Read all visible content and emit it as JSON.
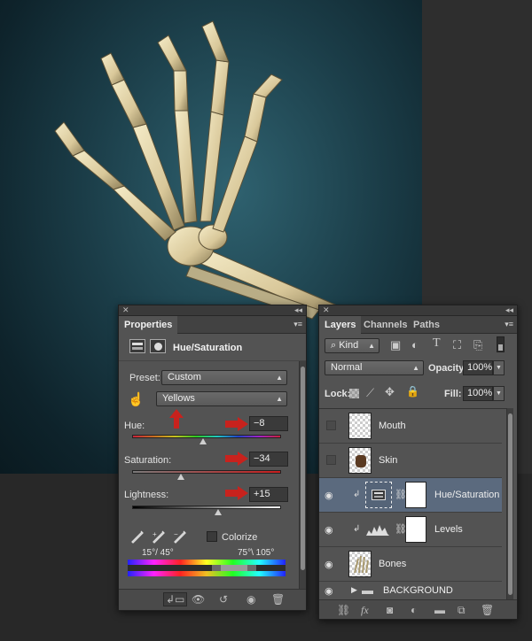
{
  "properties_panel": {
    "tab_label": "Properties",
    "adjustment_title": "Hue/Saturation",
    "preset_label": "Preset:",
    "preset_value": "Custom",
    "channel_value": "Yellows",
    "hue_label": "Hue:",
    "hue_value": "−8",
    "hue_value_fraction": 0.478,
    "saturation_label": "Saturation:",
    "saturation_value": "−34",
    "saturation_value_fraction": 0.33,
    "lightness_label": "Lightness:",
    "lightness_value": "+15",
    "lightness_value_fraction": 0.575,
    "colorize_label": "Colorize",
    "colorize_checked": false,
    "range_left": "15°/ 45°",
    "range_right": "75°\\ 105°",
    "annotation_arrow_color": "#c8221d"
  },
  "layers_panel": {
    "tabs": [
      "Layers",
      "Channels",
      "Paths"
    ],
    "filter_kind": "Kind",
    "blend_mode": "Normal",
    "opacity_label": "Opacity:",
    "opacity_value": "100%",
    "lock_label": "Lock:",
    "fill_label": "Fill:",
    "fill_value": "100%",
    "selected_color": "#5b6a7e",
    "layers": [
      {
        "name": "Mouth",
        "visible": false
      },
      {
        "name": "Skin",
        "visible": false
      },
      {
        "name": "Hue/Saturation",
        "visible": true,
        "selected": true
      },
      {
        "name": "Levels",
        "visible": true
      },
      {
        "name": "Bones",
        "visible": true
      },
      {
        "name": "BACKGROUND",
        "visible": true,
        "group": true
      }
    ]
  }
}
